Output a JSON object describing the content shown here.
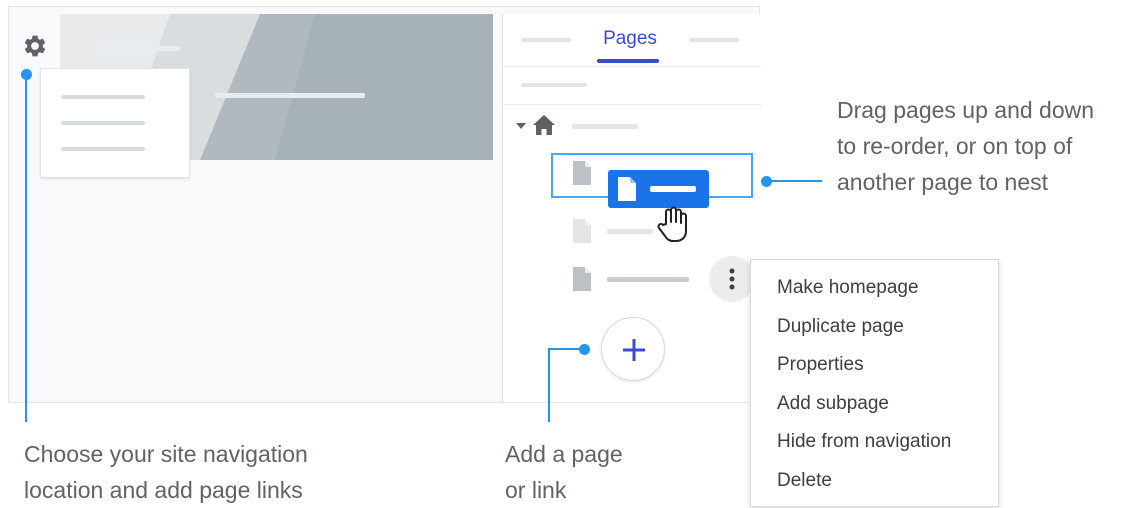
{
  "panel": {
    "tab_label": "Pages"
  },
  "context_menu": {
    "items": [
      "Make homepage",
      "Duplicate page",
      "Properties",
      "Add subpage",
      "Hide from navigation",
      "Delete"
    ]
  },
  "callouts": {
    "drag_lines": [
      "Drag pages up and down",
      "to re-order, or on top of",
      "another page to nest"
    ],
    "nav_lines": [
      "Choose your site navigation",
      "location and add page links"
    ],
    "add_lines": [
      "Add a page",
      "or link"
    ]
  },
  "icons": {
    "gear": "gear-icon",
    "home": "home-icon",
    "expand": "caret-down-icon",
    "page": "page-icon",
    "hand": "hand-cursor-icon",
    "more": "more-vert-icon",
    "add": "plus-icon"
  },
  "colors": {
    "accent": "#3c4ad0",
    "drag_blue": "#1a73e8",
    "callout_blue": "#2196f3"
  }
}
